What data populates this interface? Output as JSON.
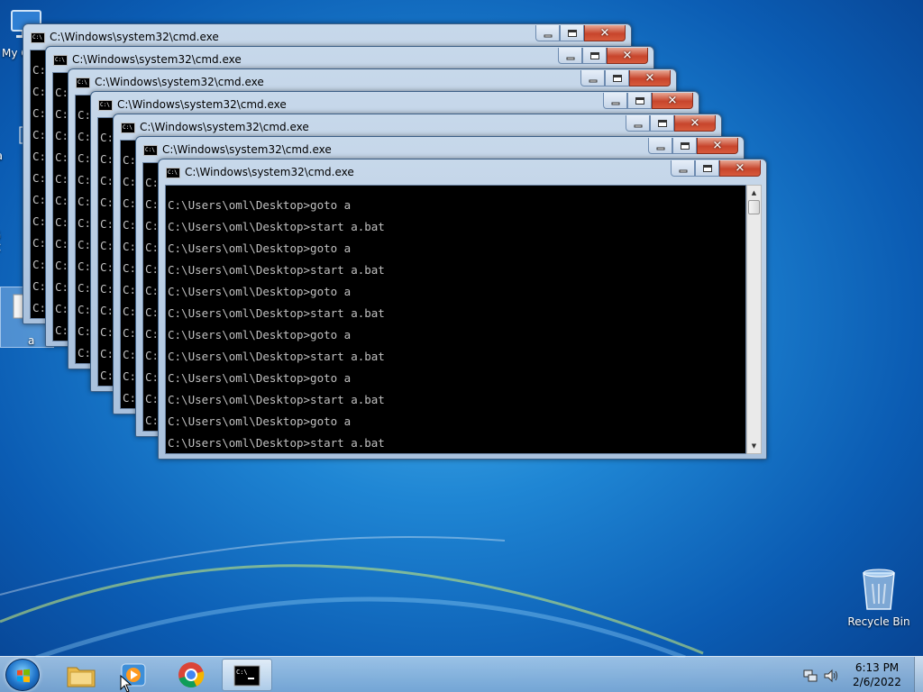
{
  "desktop": {
    "icons": [
      {
        "label": "My C"
      },
      {
        "label": "Data"
      },
      {
        "label": "G"
      },
      {
        "label": "C"
      },
      {
        "label": "a"
      }
    ],
    "recycle_bin_label": "Recycle Bin"
  },
  "windows": [
    {
      "title": "C:\\Windows\\system32\\cmd.exe",
      "lines": [
        "C:",
        "C:",
        "C:",
        "C:",
        "C:",
        "C:",
        "C:",
        "C:",
        "C:",
        "C:",
        "C:",
        "C:"
      ]
    },
    {
      "title": "C:\\Windows\\system32\\cmd.exe",
      "lines": [
        "C:",
        "C:",
        "C:",
        "C:",
        "C:",
        "C:",
        "C:",
        "C:",
        "C:",
        "C:",
        "C:",
        "C:"
      ]
    },
    {
      "title": "C:\\Windows\\system32\\cmd.exe",
      "lines": [
        "C:\\Us",
        "C:\\Us",
        "C:\\Us",
        "C:\\Us",
        "C:\\Us",
        "C:\\Us",
        "C:\\Us",
        "C:\\Us",
        "C:\\Us",
        "C:\\Us",
        "C:\\Us",
        "C:\\Us"
      ]
    },
    {
      "title": "C:\\Windows\\system32\\cmd.exe",
      "lines": [
        "C:\\Users\\",
        "C:\\Users\\",
        "C:\\Users\\",
        "C:\\Users\\",
        "C:\\Users\\",
        "C:\\Users\\",
        "C:\\Users\\",
        "C:\\Users\\",
        "C:\\Users\\",
        "C:\\Users\\",
        "C:\\Users\\",
        "C:\\Users\\"
      ]
    },
    {
      "title": "C:\\Windows\\system32\\cmd.exe",
      "lines": [
        "C:\\Users\\oml",
        "C:\\Users\\oml",
        "C:\\Users\\oml",
        "C:\\Users\\oml",
        "C:\\Users\\oml",
        "C:\\Users\\oml",
        "C:\\Users\\oml",
        "C:\\Users\\oml",
        "C:\\Users\\oml",
        "C:\\Users\\oml",
        "C:\\Users\\oml",
        "C:\\Users\\oml"
      ]
    },
    {
      "title": "C:\\Windows\\system32\\cmd.exe",
      "lines": [
        "C:\\Users\\oml\\Desk",
        "C:\\Users\\oml\\Desk",
        "C:\\Users\\oml\\Desk",
        "C:\\Users\\oml\\Desk",
        "C:\\Users\\oml\\Desk",
        "C:\\Users\\oml\\Desk",
        "C:\\Users\\oml\\Desk",
        "C:\\Users\\oml\\Desk",
        "C:\\Users\\oml\\Desk",
        "C:\\Users\\oml\\Desk",
        "C:\\Users\\oml\\Desk",
        "C:\\Users\\oml\\Desk"
      ]
    },
    {
      "title": "C:\\Windows\\system32\\cmd.exe",
      "lines": [
        "C:\\Users\\oml\\Desktop>goto a",
        "C:\\Users\\oml\\Desktop>start a.bat",
        "C:\\Users\\oml\\Desktop>goto a",
        "C:\\Users\\oml\\Desktop>start a.bat",
        "C:\\Users\\oml\\Desktop>goto a",
        "C:\\Users\\oml\\Desktop>start a.bat",
        "C:\\Users\\oml\\Desktop>goto a",
        "C:\\Users\\oml\\Desktop>start a.bat",
        "C:\\Users\\oml\\Desktop>goto a",
        "C:\\Users\\oml\\Desktop>start a.bat",
        "C:\\Users\\oml\\Desktop>goto a",
        "C:\\Users\\oml\\Desktop>start a.bat"
      ]
    }
  ],
  "taskbar": {
    "time": "6:13 PM",
    "date": "2/6/2022"
  }
}
